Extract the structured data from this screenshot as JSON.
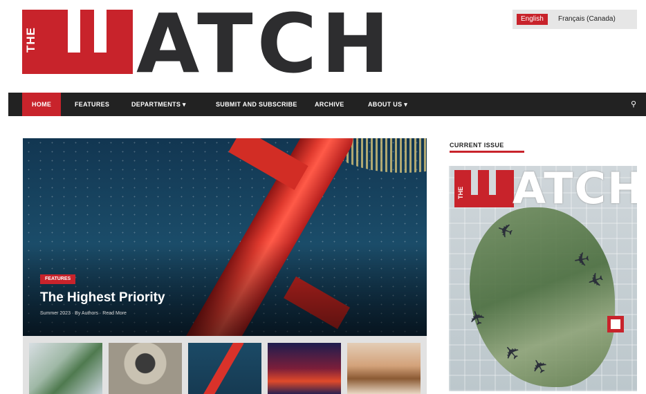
{
  "logo": {
    "the": "THE",
    "first_letter": "W",
    "rest": "ATCH"
  },
  "language": {
    "active": "English",
    "other": "Français (Canada)"
  },
  "nav": {
    "items": [
      {
        "label": "HOME",
        "active": true
      },
      {
        "label": "FEATURES"
      },
      {
        "label": "DEPARTMENTS ▾"
      },
      {
        "label": "SUBMIT AND SUBSCRIBE"
      },
      {
        "label": "ARCHIVE"
      },
      {
        "label": "ABOUT US ▾"
      }
    ],
    "search_icon": "search-icon"
  },
  "hero": {
    "badge": "FEATURES",
    "title": "The Highest Priority",
    "meta": "Summer 2023 · By Authors · Read More"
  },
  "thumbnails": [
    {
      "icon": "map-thumbnail"
    },
    {
      "icon": "satellite-thumbnail"
    },
    {
      "icon": "rocket-thumbnail"
    },
    {
      "icon": "city-thumbnail"
    },
    {
      "icon": "boot-thumbnail"
    }
  ],
  "sidebar": {
    "title": "CURRENT ISSUE",
    "cover": {
      "the": "THE",
      "w": "W",
      "rest": "ATCH"
    }
  },
  "colors": {
    "brand_red": "#c8232b",
    "nav_bg": "#222222",
    "logo_dark": "#2d2d2f"
  }
}
